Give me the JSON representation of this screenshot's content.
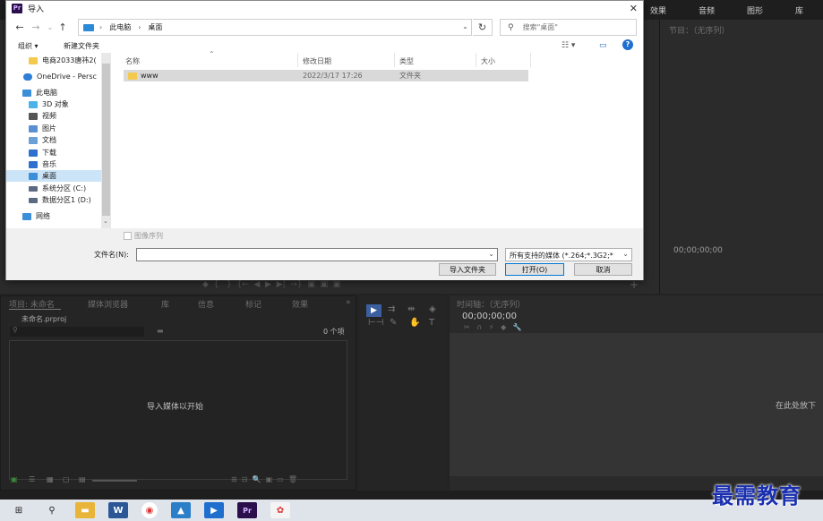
{
  "premiere": {
    "tabs": [
      "效果",
      "音频",
      "图形",
      "库"
    ],
    "program_title": "节目：（无序列）",
    "program_timecode": "00;00;00;00",
    "project_tabs": [
      "项目: 未命名",
      "媒体浏览器",
      "库",
      "信息",
      "标记",
      "效果"
    ],
    "project_more": "»",
    "project_file": "未命名.prproj",
    "project_count": "0 个项",
    "project_hint": "导入媒体以开始",
    "timeline_title": "时间轴：（无序列）",
    "timeline_timecode": "00;00;00;00",
    "timeline_hint": "在此处放下"
  },
  "dialog": {
    "title": "导入",
    "close": "✕",
    "breadcrumb": [
      "此电脑",
      "桌面"
    ],
    "search_placeholder": "搜索\"桌面\"",
    "toolbar": {
      "organize": "组织 ▾",
      "new_folder": "新建文件夹"
    },
    "tree": [
      {
        "label": "电商2033唐祎2(",
        "color": "#f3c94e"
      },
      {
        "label": "OneDrive - Persc",
        "color": "#2d7fd8"
      },
      {
        "label": "此电脑",
        "color": "#3b8ed8"
      },
      {
        "label": "3D 对象",
        "color": "#4db2e8"
      },
      {
        "label": "视频",
        "color": "#555555"
      },
      {
        "label": "图片",
        "color": "#5a8fd0"
      },
      {
        "label": "文档",
        "color": "#6a9fd8"
      },
      {
        "label": "下载",
        "color": "#2f6fd0"
      },
      {
        "label": "音乐",
        "color": "#2f6fd0"
      },
      {
        "label": "桌面",
        "color": "#3b8ed8"
      },
      {
        "label": "系统分区 (C:)",
        "color": "#5a6a80"
      },
      {
        "label": "数据分区1 (D:)",
        "color": "#5a6a80"
      },
      {
        "label": "网络",
        "color": "#3b8ed8"
      }
    ],
    "columns": [
      "名称",
      "修改日期",
      "类型",
      "大小"
    ],
    "files": [
      {
        "name": "www",
        "date": "2022/3/17 17:26",
        "type": "文件夹",
        "size": ""
      }
    ],
    "image_sequence_label": "图像序列",
    "filename_label": "文件名(N):",
    "filename_value": "",
    "filetype_value": "所有支持的媒体 (*.264;*.3G2;*",
    "buttons": {
      "import_folder": "导入文件夹",
      "open": "打开(O)",
      "cancel": "取消"
    }
  },
  "watermark": "最需教育",
  "colors": {
    "selection": "#cce4f7",
    "file_row": "#d9d9d9",
    "watermark": "#1a2fb0"
  }
}
